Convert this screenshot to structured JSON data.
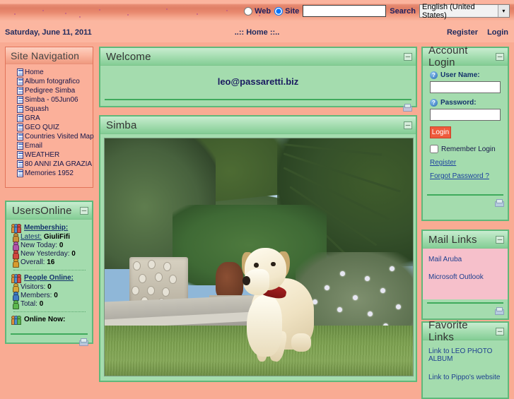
{
  "header": {
    "search_scope_web": "Web",
    "search_scope_site": "Site",
    "search_value": "",
    "search_placeholder": "",
    "search_button": "Search",
    "language": "English (United States)",
    "language_arrow": "▾"
  },
  "datestrip": {
    "date": "Saturday, June 11, 2011",
    "home_link": "..:: Home ::..",
    "register": "Register",
    "login": "Login"
  },
  "site_navigation": {
    "title": "Site Navigation",
    "items": [
      {
        "label": "Home"
      },
      {
        "label": "Album fotografico"
      },
      {
        "label": "Pedigree Simba"
      },
      {
        "label": "Simba - 05Jun06"
      },
      {
        "label": "Squash"
      },
      {
        "label": "GRA"
      },
      {
        "label": "GEO QUIZ"
      },
      {
        "label": "Countries Visited Map"
      },
      {
        "label": "Email"
      },
      {
        "label": "WEATHER"
      },
      {
        "label": "80 ANNI ZIA GRAZIA"
      },
      {
        "label": "Memories 1952"
      }
    ]
  },
  "users_online": {
    "title": "UsersOnline",
    "collapse": "─",
    "membership_heading": "Membership:",
    "membership": [
      {
        "label": "Latest:",
        "value": "GiuliFifi",
        "underline": true,
        "color": "#c8903a"
      },
      {
        "label": "New Today:",
        "value": "0",
        "underline": false,
        "color": "#b255a8"
      },
      {
        "label": "New Yesterday:",
        "value": "0",
        "underline": false,
        "color": "#d0483f"
      },
      {
        "label": "Overall:",
        "value": "16",
        "underline": false,
        "color": "#d79b2e"
      }
    ],
    "people_heading": "People Online:",
    "people": [
      {
        "label": "Visitors:",
        "value": "0",
        "color": "#d6a63a"
      },
      {
        "label": "Members:",
        "value": "0",
        "color": "#3f7bc4"
      },
      {
        "label": "Total:",
        "value": "0",
        "color": "#5cb84e"
      }
    ],
    "online_now": "Online Now:"
  },
  "welcome": {
    "title": "Welcome",
    "collapse": "─",
    "text": "leo@passaretti.biz"
  },
  "simba": {
    "title": "Simba",
    "collapse": "─",
    "photo_alt": "Yellow Labrador retriever with red collar sitting on lawn in a Mediterranean garden with palm trees, hedge, stone planter and terracotta urn"
  },
  "account_login": {
    "title": "Account Login",
    "collapse": "─",
    "username_label": "User Name:",
    "username_value": "",
    "password_label": "Password:",
    "password_value": "",
    "login_button": "Login",
    "remember_label": "Remember Login",
    "register_link": "Register",
    "forgot_link": "Forgot Password ?",
    "help_glyph": "?"
  },
  "mail_links": {
    "title": "Mail Links",
    "collapse": "─",
    "links": [
      {
        "label": "Mail Aruba"
      },
      {
        "label": "Microsoft Outlook"
      }
    ]
  },
  "favorite_links": {
    "title": "Favorite Links",
    "collapse": "─",
    "links": [
      {
        "label": "Link to LEO PHOTO ALBUM"
      },
      {
        "label": "Link to Pippo's website"
      }
    ]
  },
  "colors": {
    "page_background": "#f9ab93",
    "header_band": "#e07f66",
    "panel_green": "#a4dcae",
    "panel_border_green": "#5fb87a",
    "panel_peach": "#fbb09a",
    "mail_pink": "#f6c0cb",
    "link_blue": "#1e3f8f",
    "login_button": "#ef5a3c"
  }
}
